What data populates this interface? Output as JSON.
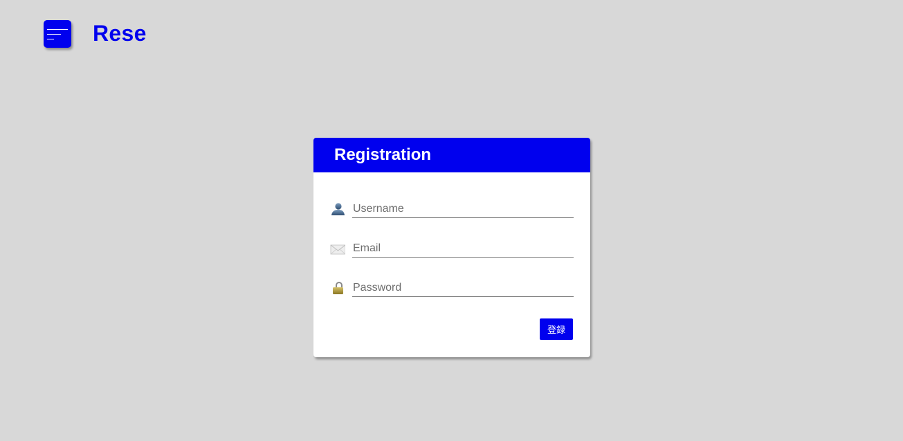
{
  "header": {
    "menu_icon": "hamburger-menu-icon",
    "brand": "Rese"
  },
  "colors": {
    "accent": "#0000ee",
    "background": "#d8d8d8",
    "card": "#ffffff"
  },
  "registration": {
    "title": "Registration",
    "fields": [
      {
        "icon": "user-icon",
        "placeholder": "Username",
        "value": ""
      },
      {
        "icon": "mail-icon",
        "placeholder": "Email",
        "value": ""
      },
      {
        "icon": "lock-icon",
        "placeholder": "Password",
        "value": ""
      }
    ],
    "submit_label": "登録"
  }
}
